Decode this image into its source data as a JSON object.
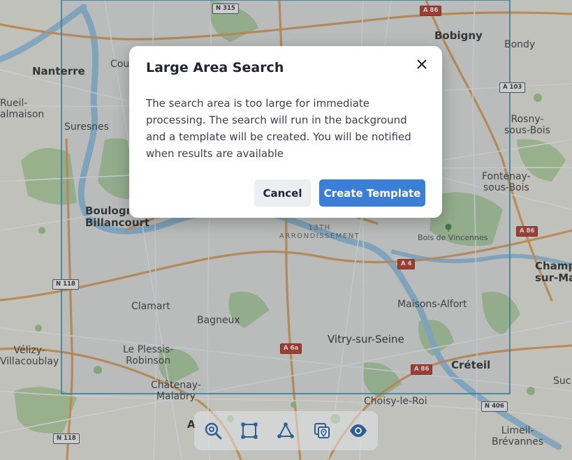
{
  "map": {
    "places": [
      {
        "key": "nanterre",
        "text": "Nanterre"
      },
      {
        "key": "courbevoie",
        "text": "Cou"
      },
      {
        "key": "rueil",
        "text": "Rueil-\nalmaison"
      },
      {
        "key": "suresnes",
        "text": "Suresnes"
      },
      {
        "key": "boulogne",
        "text": "Boulogne-\nBillancourt"
      },
      {
        "key": "bobigny",
        "text": "Bobigny"
      },
      {
        "key": "bondy",
        "text": "Bondy"
      },
      {
        "key": "rosny",
        "text": "Rosny-\nsous-Bois"
      },
      {
        "key": "fontenay",
        "text": "Fontenay-\nsous-Bois"
      },
      {
        "key": "champigny",
        "text": "Champ\nsur-Ma"
      },
      {
        "key": "clamart",
        "text": "Clamart"
      },
      {
        "key": "bagneux",
        "text": "Bagneux"
      },
      {
        "key": "velizy",
        "text": "Vélizy-\nVillacoublay"
      },
      {
        "key": "plessis",
        "text": "Le Plessis-\nRobinson"
      },
      {
        "key": "chatenay",
        "text": "Châtenay-\nMalabry"
      },
      {
        "key": "vitry",
        "text": "Vitry-sur-Seine"
      },
      {
        "key": "maisons",
        "text": "Maisons-Alfort"
      },
      {
        "key": "creteil",
        "text": "Créteil"
      },
      {
        "key": "choisy",
        "text": "Choisy-le-Roi"
      },
      {
        "key": "sucy",
        "text": "Suc"
      },
      {
        "key": "limeil",
        "text": "Limeil-\nBrévannes"
      },
      {
        "key": "antony",
        "text": "A"
      },
      {
        "key": "arrondissement",
        "text": "13TH\nARRONDISSEMENT"
      },
      {
        "key": "vincennes",
        "text": "Bois de Vincennes"
      }
    ],
    "roads": [
      {
        "key": "n315",
        "text": "N 315",
        "type": "n"
      },
      {
        "key": "a86top",
        "text": "A 86",
        "type": "a"
      },
      {
        "key": "a103",
        "text": "A 103",
        "type": "n"
      },
      {
        "key": "a86right",
        "text": "A 86",
        "type": "a"
      },
      {
        "key": "a4",
        "text": "A 4",
        "type": "a"
      },
      {
        "key": "n118a",
        "text": "N 118",
        "type": "n"
      },
      {
        "key": "a6a",
        "text": "A 6a",
        "type": "a"
      },
      {
        "key": "a86bottom",
        "text": "A 86",
        "type": "a"
      },
      {
        "key": "n406",
        "text": "N 406",
        "type": "n"
      },
      {
        "key": "n118b",
        "text": "N 118",
        "type": "n"
      }
    ]
  },
  "dialog": {
    "title": "Large Area Search",
    "body": "The search area is too large for immediate processing. The search will run in the background and a template will be created. You will be notified when results are available",
    "cancel_label": "Cancel",
    "confirm_label": "Create Template",
    "close_icon": "close-icon",
    "primary_color": "#3a7fd5"
  },
  "toolbar": {
    "tools": [
      {
        "name": "zoom-search-icon"
      },
      {
        "name": "rectangle-select-icon"
      },
      {
        "name": "polygon-select-icon"
      },
      {
        "name": "location-layers-icon"
      },
      {
        "name": "visibility-eye-icon"
      }
    ],
    "icon_color": "#2e5f93"
  },
  "selection": {
    "color": "#2c8fb5"
  }
}
